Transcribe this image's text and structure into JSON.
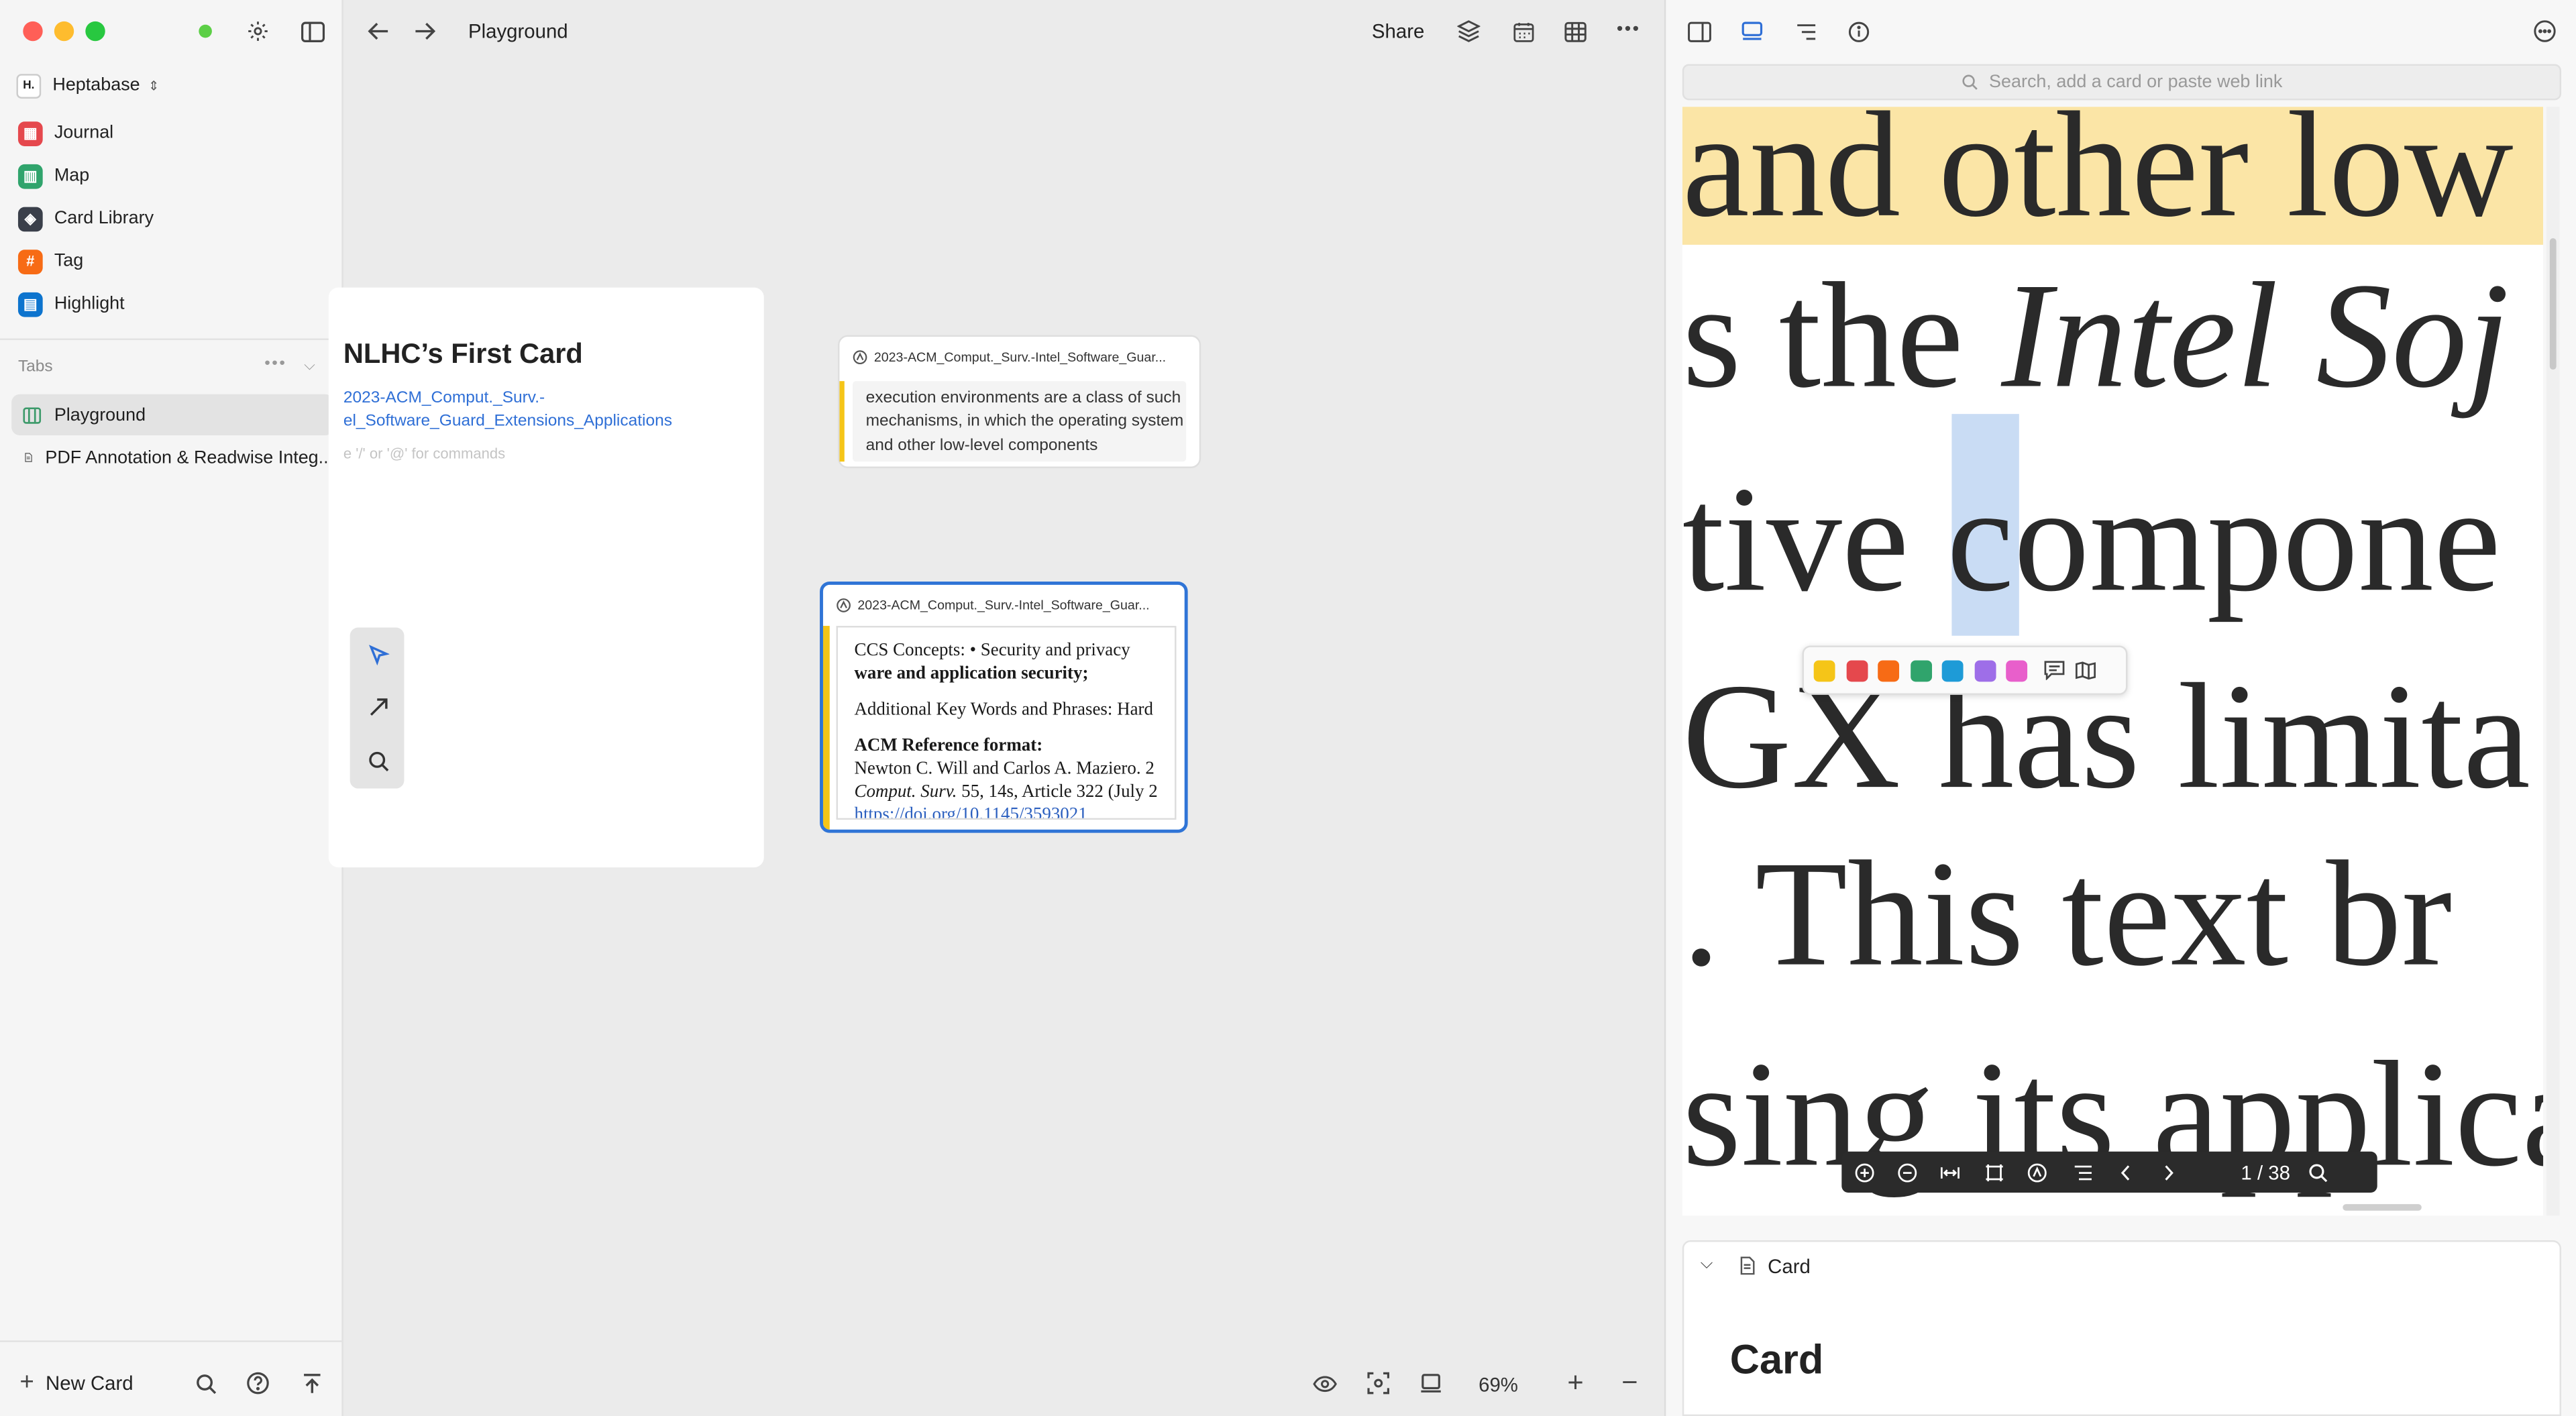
{
  "window": {
    "title": "Playground"
  },
  "sidebar": {
    "workspace": "Heptabase",
    "workspace_logo": "H.",
    "items": [
      {
        "label": "Journal",
        "icon": "calendar-icon",
        "color": "#e5484d"
      },
      {
        "label": "Map",
        "icon": "map-icon",
        "color": "#30a46c"
      },
      {
        "label": "Card Library",
        "icon": "layers-icon",
        "color": "#3a3f4a"
      },
      {
        "label": "Tag",
        "icon": "hash-icon",
        "color": "#f76b15"
      },
      {
        "label": "Highlight",
        "icon": "highlight-icon",
        "color": "#0d74ce"
      }
    ],
    "tabs_header": "Tabs",
    "tabs": [
      {
        "label": "Playground",
        "icon": "whiteboard-icon",
        "active": true
      },
      {
        "label": "PDF Annotation & Readwise Integ...",
        "icon": "document-icon",
        "active": false
      }
    ],
    "new_card": "New Card"
  },
  "toolbar": {
    "share": "Share"
  },
  "canvas": {
    "main_card": {
      "title": "NLHC’s First Card",
      "link_line1": "2023-ACM_Comput._Surv.-",
      "link_line2": "el_Software_Guard_Extensions_Applications",
      "placeholder": "e '/' or '@' for commands"
    },
    "highlight_card": {
      "source": "2023-ACM_Comput._Surv.-Intel_Software_Guar...",
      "text": "execution environments are a class of such mechanisms, in which the operating system and other low-level components"
    },
    "image_card": {
      "source": "2023-ACM_Comput._Surv.-Intel_Software_Guar...",
      "line1_a": "CCS Concepts:  • Security and privacy",
      "line1_b": "ware and application security;",
      "line2": "Additional Key Words and Phrases: Hard",
      "line3": "ACM Reference format:",
      "line4": "Newton C. Will and Carlos A. Maziero. 2",
      "line5_i": "Comput. Surv.",
      "line5_r": " 55, 14s, Article 322 (July 2",
      "line6": "https://doi.org/10.1145/3593021"
    },
    "zoom": "69%"
  },
  "pdf": {
    "search_placeholder": "Search, add a card or paste web link",
    "lines": [
      {
        "text": "and other low"
      },
      {
        "pre": "s the ",
        "ital": "Intel Soj"
      },
      {
        "pre": "tive ",
        "hl": "c",
        "post": "ompone"
      },
      {
        "text": "GX has limita"
      },
      {
        "text": ". This text br"
      },
      {
        "text": "sing its applica"
      }
    ],
    "colors": [
      "#f5c518",
      "#e5484d",
      "#f76b15",
      "#30a46c",
      "#1e9bd7",
      "#9e6ee8",
      "#e85fcb"
    ],
    "page": "1 / 38"
  },
  "card_section": {
    "label": "Card",
    "title": "Card"
  }
}
